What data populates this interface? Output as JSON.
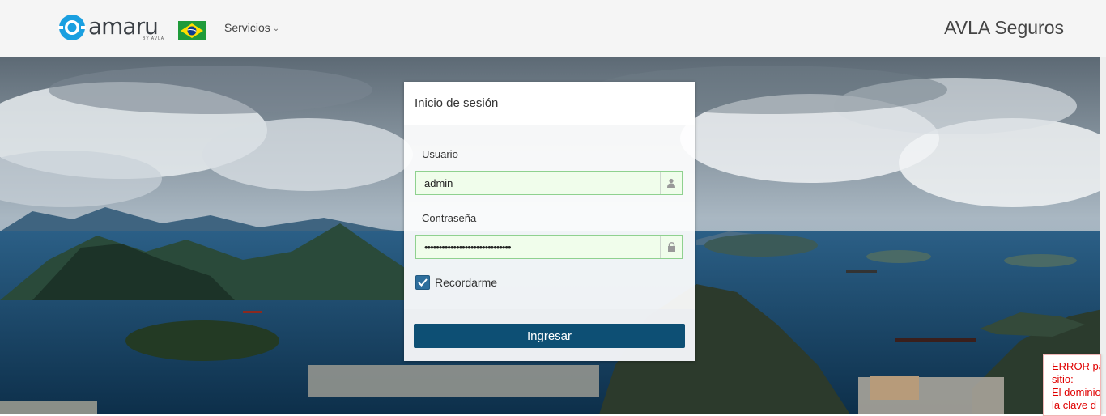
{
  "header": {
    "logo_text": "amaru",
    "logo_subtext": "BY AVLA",
    "flag": "brazil-flag",
    "nav": {
      "servicios_label": "Servicios"
    },
    "brand_name": "AVLA Seguros"
  },
  "login": {
    "title": "Inicio de sesión",
    "username_label": "Usuario",
    "username_value": "admin",
    "username_icon": "user-icon",
    "password_label": "Contraseña",
    "password_value": "••••••••••••••••••••••••••••••",
    "password_icon": "lock-icon",
    "remember_label": "Recordarme",
    "remember_checked": true,
    "submit_label": "Ingresar"
  },
  "error": {
    "line1": "ERROR pa",
    "line2": "sitio:",
    "line3": "El dominio",
    "line4": "la clave d"
  },
  "colors": {
    "accent": "#0d4f74",
    "logo": "#1a9fe0",
    "input_valid_border": "#8fd18f",
    "input_valid_bg": "#f0fdeb",
    "error": "#e00000"
  }
}
